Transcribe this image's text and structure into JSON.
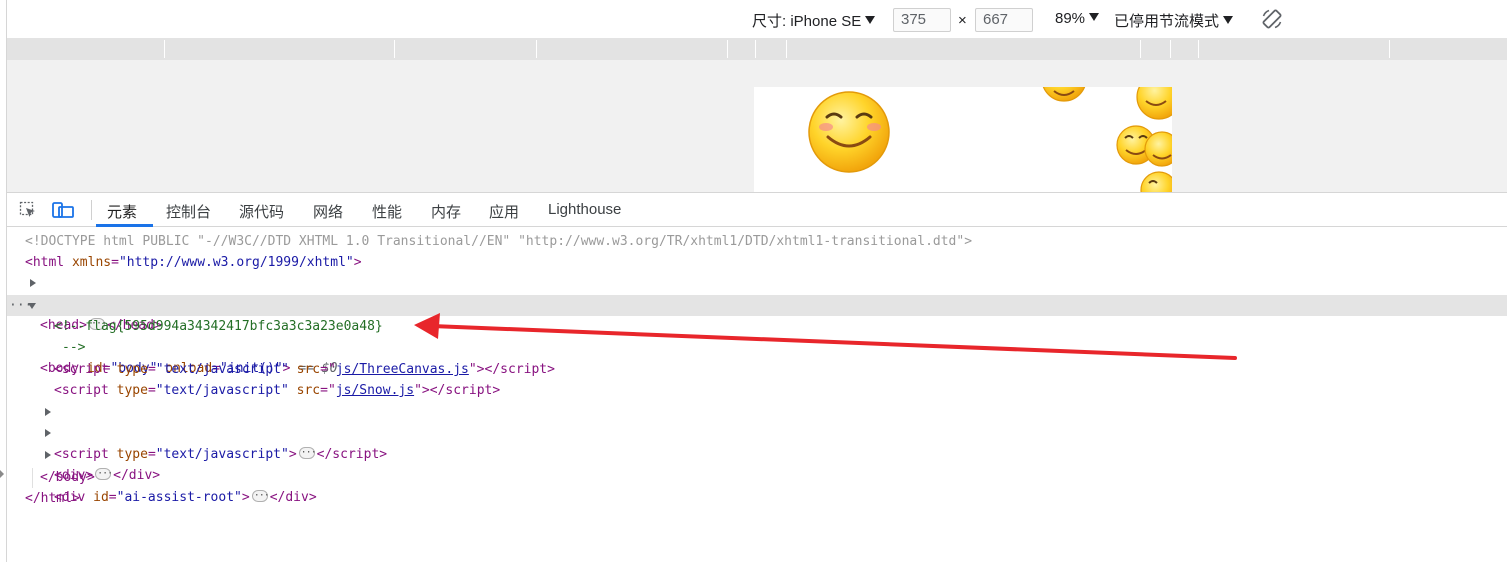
{
  "device_toolbar": {
    "dimensions_label": "尺寸: iPhone SE",
    "width_value": "375",
    "times_sign": "×",
    "height_value": "667",
    "zoom": "89%",
    "throttle": "已停用节流模式",
    "rotate_icon": "rotate-icon"
  },
  "tabs": [
    {
      "label": "元素"
    },
    {
      "label": "控制台"
    },
    {
      "label": "源代码"
    },
    {
      "label": "网络"
    },
    {
      "label": "性能"
    },
    {
      "label": "内存"
    },
    {
      "label": "应用"
    },
    {
      "label": "Lighthouse"
    }
  ],
  "tree": {
    "doctype": "<!DOCTYPE html PUBLIC \"-//W3C//DTD XHTML 1.0 Transitional//EN\" \"http://www.w3.org/TR/xhtml1/DTD/xhtml1-transitional.dtd\">",
    "html_open": "<html",
    "html_attr": " xmlns",
    "html_val": "\"http://www.w3.org/1999/xhtml\"",
    "head_open": "<head>",
    "head_close": "</head>",
    "body_open": "<body",
    "body_id_attr": " id",
    "body_id_val": "\"body\"",
    "body_onload_attr": " onload",
    "body_onload_val": "\"init()\"",
    "body_eq": "== $0",
    "comment1": "<!--flag{595d994a34342417bfc3a3c3a23e0a48}",
    "comment2": "-->",
    "script1_src": "js/ThreeCanvas.js",
    "script2_src": "js/Snow.js",
    "script_type_val": "\"text/javascript\"",
    "div_id_val": "\"ai-assist-root\"",
    "body_close": "</body>",
    "html_close": "</html>"
  },
  "colors": {
    "tag": "#881280",
    "attr_name": "#994500",
    "attr_value": "#1a1aa6",
    "comment": "#236e25",
    "accent": "#1a73e8",
    "annotation_arrow": "#e8262b"
  }
}
